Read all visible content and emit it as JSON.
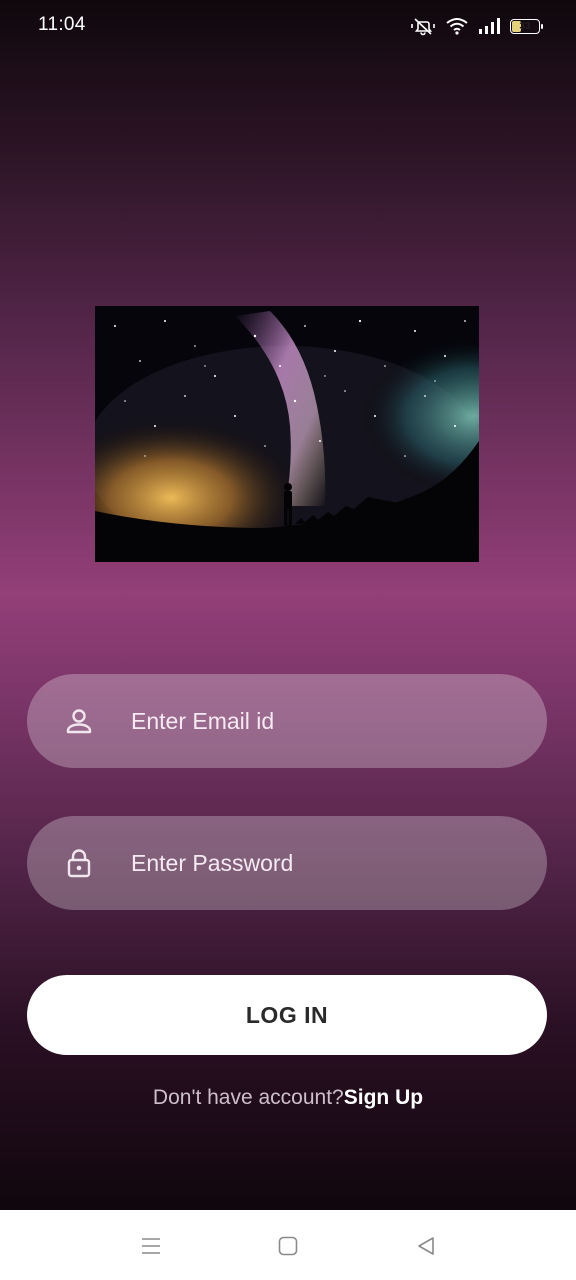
{
  "status_bar": {
    "time": "11:04",
    "battery_level": "33",
    "icons": [
      "mute-vibrate-icon",
      "wifi-icon",
      "signal-icon",
      "battery-icon"
    ]
  },
  "hero_image": {
    "description_icon": "milky-way-image"
  },
  "login_form": {
    "email_placeholder": "Enter Email id",
    "email_value": "",
    "password_placeholder": "Enter Password",
    "password_value": "",
    "login_label": "LOG IN",
    "signup_prompt": "Don't have account?",
    "signup_link": "Sign Up"
  },
  "navigation_bar": {
    "icons": [
      "menu-icon",
      "home-icon",
      "back-icon"
    ]
  },
  "colors": {
    "accent_mid": "#933f78",
    "button_bg": "#ffffff",
    "button_text": "#2a2a2a"
  }
}
